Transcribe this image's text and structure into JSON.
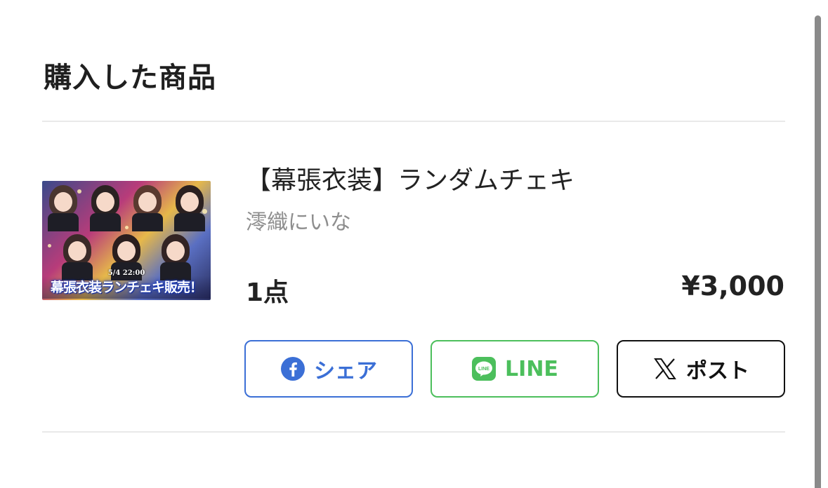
{
  "section": {
    "title": "購入した商品"
  },
  "product": {
    "name": "【幕張衣装】ランダムチェキ",
    "seller": "澪織にいな",
    "quantity": "1点",
    "price": "¥3,000",
    "thumbnail": {
      "banner_small": "5/4 22:00",
      "banner": "幕張衣装ランチェキ販売！"
    }
  },
  "share": {
    "facebook": {
      "label": "シェア",
      "icon": "facebook-icon",
      "color": "#3b6fd6"
    },
    "line": {
      "label": "LINE",
      "icon": "line-icon",
      "color": "#4cbf5c"
    },
    "x": {
      "label": "ポスト",
      "icon": "x-icon",
      "color": "#111111"
    }
  }
}
